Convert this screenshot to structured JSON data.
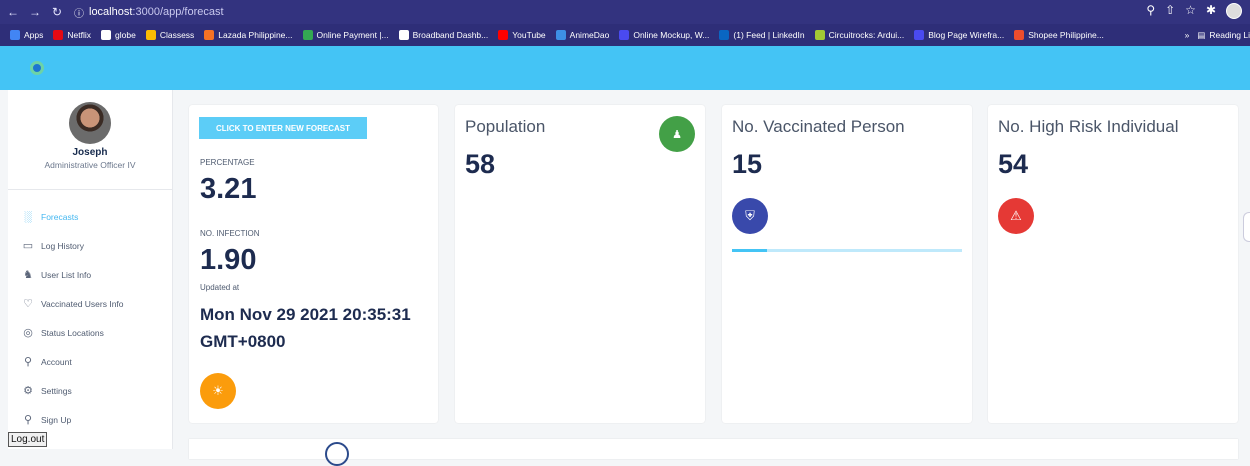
{
  "browser": {
    "url_host": "localhost",
    "url_path": ":3000/app/forecast",
    "bookmarks": [
      {
        "label": "Apps",
        "color": "#4285f4"
      },
      {
        "label": "Netflix",
        "color": "#e50914"
      },
      {
        "label": "globe",
        "color": "#ffffff"
      },
      {
        "label": "Classess",
        "color": "#fbbc04"
      },
      {
        "label": "Lazada Philippine...",
        "color": "#f57224"
      },
      {
        "label": "Online Payment |...",
        "color": "#34a853"
      },
      {
        "label": "Broadband Dashb...",
        "color": "#ffffff"
      },
      {
        "label": "YouTube",
        "color": "#ff0000"
      },
      {
        "label": "AnimeDao",
        "color": "#3d8fe5"
      },
      {
        "label": "Online Mockup, W...",
        "color": "#4a4af0"
      },
      {
        "label": "(1) Feed | LinkedIn",
        "color": "#0a66c2"
      },
      {
        "label": "Circuitrocks: Ardui...",
        "color": "#a3c935"
      },
      {
        "label": "Blog Page Wirefra...",
        "color": "#4a4af0"
      },
      {
        "label": "Shopee Philippine...",
        "color": "#ee4d2d"
      }
    ],
    "reading_list": "Reading Li"
  },
  "sidebar": {
    "user_name": "Joseph",
    "user_role": "Administrative Officer IV",
    "items": [
      {
        "label": "Forecasts",
        "icon": "bar-chart-icon"
      },
      {
        "label": "Log History",
        "icon": "monitor-icon"
      },
      {
        "label": "User List Info",
        "icon": "users-icon"
      },
      {
        "label": "Vaccinated Users Info",
        "icon": "heart-icon"
      },
      {
        "label": "Status Locations",
        "icon": "location-icon"
      },
      {
        "label": "Account",
        "icon": "user-icon"
      },
      {
        "label": "Settings",
        "icon": "gear-icon"
      },
      {
        "label": "Sign Up",
        "icon": "user-plus-icon"
      }
    ],
    "logout_label": "Log.out"
  },
  "forecast_card": {
    "button_label": "CLICK TO ENTER NEW FORECAST",
    "percentage_label": "PERCENTAGE",
    "percentage_value": "3.21",
    "infection_label": "NO. INFECTION",
    "infection_value": "1.90",
    "updated_label": "Updated at",
    "updated_value": "Mon Nov 29 2021 20:35:31 GMT+0800",
    "icon_color": "#fb9c0c"
  },
  "stats": [
    {
      "title": "Population",
      "value": "58",
      "icon": "people-icon",
      "color": "#43a047"
    },
    {
      "title": "No. Vaccinated Person",
      "value": "15",
      "icon": "shield-icon",
      "color": "#3949ab",
      "progress": 0.15
    },
    {
      "title": "No. High Risk Individual",
      "value": "54",
      "icon": "warning-icon",
      "color": "#e53935"
    }
  ]
}
